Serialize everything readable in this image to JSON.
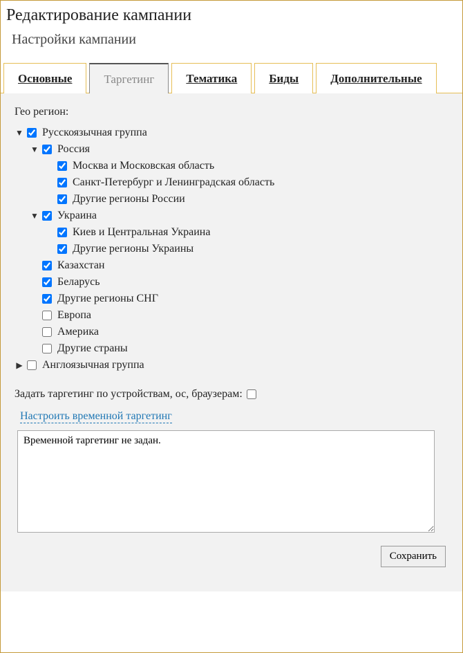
{
  "page_title": "Редактирование кампании",
  "subtitle": "Настройки кампании",
  "tabs": [
    {
      "id": "main",
      "label": "Основные",
      "active": false
    },
    {
      "id": "targeting",
      "label": "Таргетинг",
      "active": true
    },
    {
      "id": "theme",
      "label": "Тематика",
      "active": false
    },
    {
      "id": "bids",
      "label": "Биды",
      "active": false
    },
    {
      "id": "extra",
      "label": "Дополнительные",
      "active": false
    }
  ],
  "geo_label": "Гео регион:",
  "geo_tree": [
    {
      "label": "Русскоязычная группа",
      "checked": true,
      "expanded": true,
      "children": [
        {
          "label": "Россия",
          "checked": true,
          "expanded": true,
          "children": [
            {
              "label": "Москва и Московская область",
              "checked": true
            },
            {
              "label": "Санкт-Петербург и Ленинградская область",
              "checked": true
            },
            {
              "label": "Другие регионы России",
              "checked": true
            }
          ]
        },
        {
          "label": "Украина",
          "checked": true,
          "expanded": true,
          "children": [
            {
              "label": "Киев и Центральная Украина",
              "checked": true
            },
            {
              "label": "Другие регионы Украины",
              "checked": true
            }
          ]
        },
        {
          "label": "Казахстан",
          "checked": true
        },
        {
          "label": "Беларусь",
          "checked": true
        },
        {
          "label": "Другие регионы СНГ",
          "checked": true
        },
        {
          "label": "Европа",
          "checked": false
        },
        {
          "label": "Америка",
          "checked": false
        },
        {
          "label": "Другие страны",
          "checked": false
        }
      ]
    },
    {
      "label": "Англоязычная группа",
      "checked": false,
      "expanded": false,
      "children": []
    }
  ],
  "device_targeting_label": "Задать таргетинг по устройствам, ос, браузерам:",
  "device_targeting_checked": false,
  "time_targeting_link": "Настроить временной таргетинг",
  "time_targeting_value": "Временной таргетинг не задан.",
  "save_button": "Сохранить"
}
